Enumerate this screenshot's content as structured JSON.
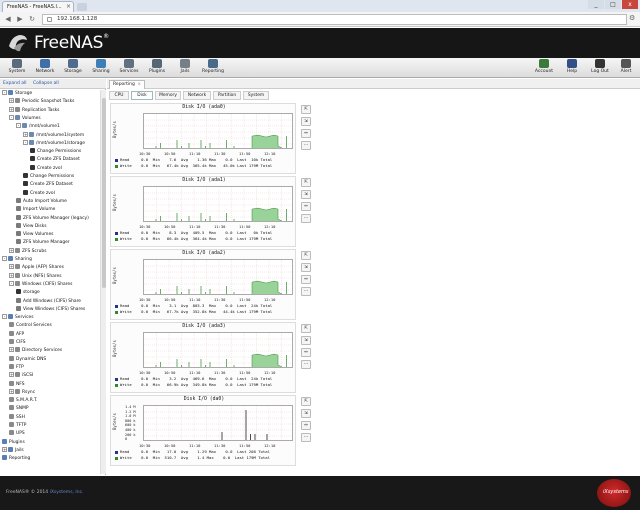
{
  "browser": {
    "tab_title": "FreeNAS - FreeNAS.l...",
    "url": "192.168.1.128",
    "window_controls": [
      "_",
      "□",
      "x"
    ]
  },
  "app": {
    "logo_text": "FreeNAS",
    "logo_mark": "®"
  },
  "toolbar": {
    "left": [
      "System",
      "Network",
      "Storage",
      "Sharing",
      "Services",
      "Plugins",
      "Jails",
      "Reporting"
    ],
    "right": [
      "Account",
      "Help",
      "Log Out",
      "Alert"
    ]
  },
  "tree_header": [
    "Expand all",
    "Collapse all"
  ],
  "tree": [
    {
      "label": "Storage",
      "indent": 0,
      "ex": "-",
      "color": "#5a7fb5"
    },
    {
      "label": "Periodic Snapshot Tasks",
      "indent": 1,
      "ex": "+",
      "color": "#8a8a8a"
    },
    {
      "label": "Replication Tasks",
      "indent": 1,
      "ex": "+",
      "color": "#8a8a8a"
    },
    {
      "label": "Volumes",
      "indent": 1,
      "ex": "-",
      "color": "#6c89b0"
    },
    {
      "label": "/mnt/volume1",
      "indent": 2,
      "ex": "-",
      "color": "#6c89b0"
    },
    {
      "label": "/mnt/volume1/system",
      "indent": 3,
      "ex": "+",
      "color": "#6c89b0"
    },
    {
      "label": "/mnt/volume1/storage",
      "indent": 3,
      "ex": "-",
      "color": "#6c89b0"
    },
    {
      "label": "Change Permissions",
      "indent": 4,
      "ex": "",
      "color": "#333"
    },
    {
      "label": "Create ZFS Dataset",
      "indent": 4,
      "ex": "",
      "color": "#333"
    },
    {
      "label": "Create zvol",
      "indent": 4,
      "ex": "",
      "color": "#333"
    },
    {
      "label": "Change Permissions",
      "indent": 3,
      "ex": "",
      "color": "#333"
    },
    {
      "label": "Create ZFS Dataset",
      "indent": 3,
      "ex": "",
      "color": "#333"
    },
    {
      "label": "Create zvol",
      "indent": 3,
      "ex": "",
      "color": "#333"
    },
    {
      "label": "Auto Import Volume",
      "indent": 2,
      "ex": "",
      "color": "#7a7a7a"
    },
    {
      "label": "Import Volume",
      "indent": 2,
      "ex": "",
      "color": "#7a7a7a"
    },
    {
      "label": "ZFS Volume Manager (legacy)",
      "indent": 2,
      "ex": "",
      "color": "#7a7a7a"
    },
    {
      "label": "View Disks",
      "indent": 2,
      "ex": "",
      "color": "#7a7a7a"
    },
    {
      "label": "View Volumes",
      "indent": 2,
      "ex": "",
      "color": "#7a7a7a"
    },
    {
      "label": "ZFS Volume Manager",
      "indent": 2,
      "ex": "",
      "color": "#7a7a7a"
    },
    {
      "label": "ZFS Scrubs",
      "indent": 1,
      "ex": "+",
      "color": "#8a8a8a"
    },
    {
      "label": "Sharing",
      "indent": 0,
      "ex": "-",
      "color": "#5a7fb5"
    },
    {
      "label": "Apple (AFP) Shares",
      "indent": 1,
      "ex": "+",
      "color": "#8a8a8a"
    },
    {
      "label": "Unix (NFS) Shares",
      "indent": 1,
      "ex": "+",
      "color": "#8a8a8a"
    },
    {
      "label": "Windows (CIFS) Shares",
      "indent": 1,
      "ex": "-",
      "color": "#8a8a8a"
    },
    {
      "label": "storage",
      "indent": 2,
      "ex": "",
      "color": "#333"
    },
    {
      "label": "Add Windows (CIFS) Share",
      "indent": 2,
      "ex": "",
      "color": "#7a7a7a"
    },
    {
      "label": "View Windows (CIFS) Shares",
      "indent": 2,
      "ex": "",
      "color": "#7a7a7a"
    },
    {
      "label": "Services",
      "indent": 0,
      "ex": "-",
      "color": "#5a7fb5"
    },
    {
      "label": "Control Services",
      "indent": 1,
      "ex": "",
      "color": "#8a8a8a"
    },
    {
      "label": "AFP",
      "indent": 1,
      "ex": "",
      "color": "#8a8a8a"
    },
    {
      "label": "CIFS",
      "indent": 1,
      "ex": "",
      "color": "#8a8a8a"
    },
    {
      "label": "Directory Services",
      "indent": 1,
      "ex": "+",
      "color": "#8a8a8a"
    },
    {
      "label": "Dynamic DNS",
      "indent": 1,
      "ex": "",
      "color": "#8a8a8a"
    },
    {
      "label": "FTP",
      "indent": 1,
      "ex": "",
      "color": "#8a8a8a"
    },
    {
      "label": "iSCSI",
      "indent": 1,
      "ex": "+",
      "color": "#8a8a8a"
    },
    {
      "label": "NFS",
      "indent": 1,
      "ex": "",
      "color": "#8a8a8a"
    },
    {
      "label": "Rsync",
      "indent": 1,
      "ex": "+",
      "color": "#8a8a8a"
    },
    {
      "label": "S.M.A.R.T.",
      "indent": 1,
      "ex": "",
      "color": "#8a8a8a"
    },
    {
      "label": "SNMP",
      "indent": 1,
      "ex": "",
      "color": "#8a8a8a"
    },
    {
      "label": "SSH",
      "indent": 1,
      "ex": "",
      "color": "#8a8a8a"
    },
    {
      "label": "TFTP",
      "indent": 1,
      "ex": "",
      "color": "#8a8a8a"
    },
    {
      "label": "UPS",
      "indent": 1,
      "ex": "",
      "color": "#8a8a8a"
    },
    {
      "label": "Plugins",
      "indent": 0,
      "ex": "",
      "color": "#5a7fb5"
    },
    {
      "label": "Jails",
      "indent": 0,
      "ex": "+",
      "color": "#5a7fb5"
    },
    {
      "label": "Reporting",
      "indent": 0,
      "ex": "",
      "color": "#5a7fb5"
    }
  ],
  "report_tab": "Reporting",
  "report_tab_close": "x",
  "subtabs": [
    "CPU",
    "Disk",
    "Memory",
    "Network",
    "Partition",
    "System"
  ],
  "selected_subtab": "Disk",
  "side_buttons": [
    "⇱",
    "⇲",
    "↔",
    "⋯"
  ],
  "chart_data": [
    {
      "type": "area",
      "title": "Disk I/O (ada0)",
      "ylabel": "Bytes/s",
      "xticks": [
        "10:30",
        "10:40",
        "10:50",
        "11:00",
        "11:10",
        "11:20",
        "11:30",
        "11:40",
        "11:50",
        "12:00",
        "12:10",
        "12:20"
      ],
      "yticks": [
        "",
        "",
        "",
        ""
      ],
      "legend": [
        "Read     0.0  Min    7.6  Avg    1.36 Max    0.0  Last  10k Total",
        "Write    0.0  Min   67.4k Avg  365.4k Max   45.0k Last 179M Total"
      ],
      "spike_color": "#cc0000",
      "spikes": [
        0.08,
        0.11,
        0.22,
        0.25,
        0.3,
        0.38,
        0.41,
        0.44,
        0.55,
        0.6
      ],
      "block": [
        0.72,
        0.92,
        0.7
      ]
    },
    {
      "type": "area",
      "title": "Disk I/O (ada1)",
      "ylabel": "Bytes/s",
      "xticks": [
        "10:30",
        "10:40",
        "10:50",
        "11:00",
        "11:10",
        "11:20",
        "11:30",
        "11:40",
        "11:50",
        "12:00",
        "12:10",
        "12:20"
      ],
      "yticks": [
        "",
        "",
        "",
        ""
      ],
      "legend": [
        "Read     0.0  Min    8.3  Avg  409.5  Max    0.0  Last   0k Total",
        "Write    0.0  Min   66.4k Avg  364.4k Max    0.0  Last 179M Total"
      ],
      "spike_color": "#2a6a2a",
      "spikes": [
        0.08,
        0.11,
        0.22,
        0.25,
        0.3,
        0.38,
        0.41,
        0.44,
        0.55,
        0.6
      ],
      "block": [
        0.72,
        0.92,
        0.68
      ]
    },
    {
      "type": "area",
      "title": "Disk I/O (ada2)",
      "ylabel": "Bytes/s",
      "xticks": [
        "10:30",
        "10:40",
        "10:50",
        "11:00",
        "11:10",
        "11:20",
        "11:30",
        "11:40",
        "11:50",
        "12:00",
        "12:10",
        "12:20"
      ],
      "yticks": [
        "",
        "",
        "",
        ""
      ],
      "legend": [
        "Read     0.0  Min    3.1  Avg  803.3  Max    0.0  Last  24k Total",
        "Write    0.0  Min   67.7k Avg  352.8k Max   44.4k Last 179M Total"
      ],
      "spike_color": "#2a6a2a",
      "spikes": [
        0.08,
        0.11,
        0.22,
        0.25,
        0.3,
        0.38,
        0.41,
        0.44,
        0.55,
        0.6
      ],
      "block": [
        0.72,
        0.92,
        0.71
      ]
    },
    {
      "type": "area",
      "title": "Disk I/O (ada3)",
      "ylabel": "Bytes/s",
      "xticks": [
        "10:30",
        "10:40",
        "10:50",
        "11:00",
        "11:10",
        "11:20",
        "11:30",
        "11:40",
        "11:50",
        "12:00",
        "12:10",
        "12:20"
      ],
      "yticks": [
        "",
        "",
        "",
        ""
      ],
      "legend": [
        "Read     0.0  Min    3.2  Avg  469.6  Max    0.0  Last  24k Total",
        "Write    0.0  Min   66.9k Avg  349.8k Max    0.0  Last 179M Total"
      ],
      "spike_color": "#2a6a2a",
      "spikes": [
        0.08,
        0.11,
        0.22,
        0.25,
        0.3,
        0.38,
        0.41,
        0.44,
        0.55,
        0.6
      ],
      "block": [
        0.72,
        0.92,
        0.69
      ]
    },
    {
      "type": "line",
      "title": "Disk I/O (da0)",
      "ylabel": "Bytes/s",
      "xticks": [
        "10:30",
        "10:40",
        "10:50",
        "11:00",
        "11:10",
        "11:20",
        "11:30",
        "11:40",
        "11:50",
        "12:00",
        "12:10",
        "12:20"
      ],
      "yticks": [
        "1.4 M",
        "1.2 M",
        "1.0 M",
        "800 k",
        "600 k",
        "400 k",
        "200 k",
        "0"
      ],
      "legend": [
        "Read     0.0  Min   17.0  Avg    1.29 Max    0.0  Last 208 Total",
        "Write    0.0  Min  510.7  Avg    1.4 Max    0.0  Last 179M Total"
      ],
      "spike_color": "#000000",
      "spikes": [
        0.52,
        0.68,
        0.71,
        0.74,
        0.82
      ],
      "block": null
    }
  ]
}
